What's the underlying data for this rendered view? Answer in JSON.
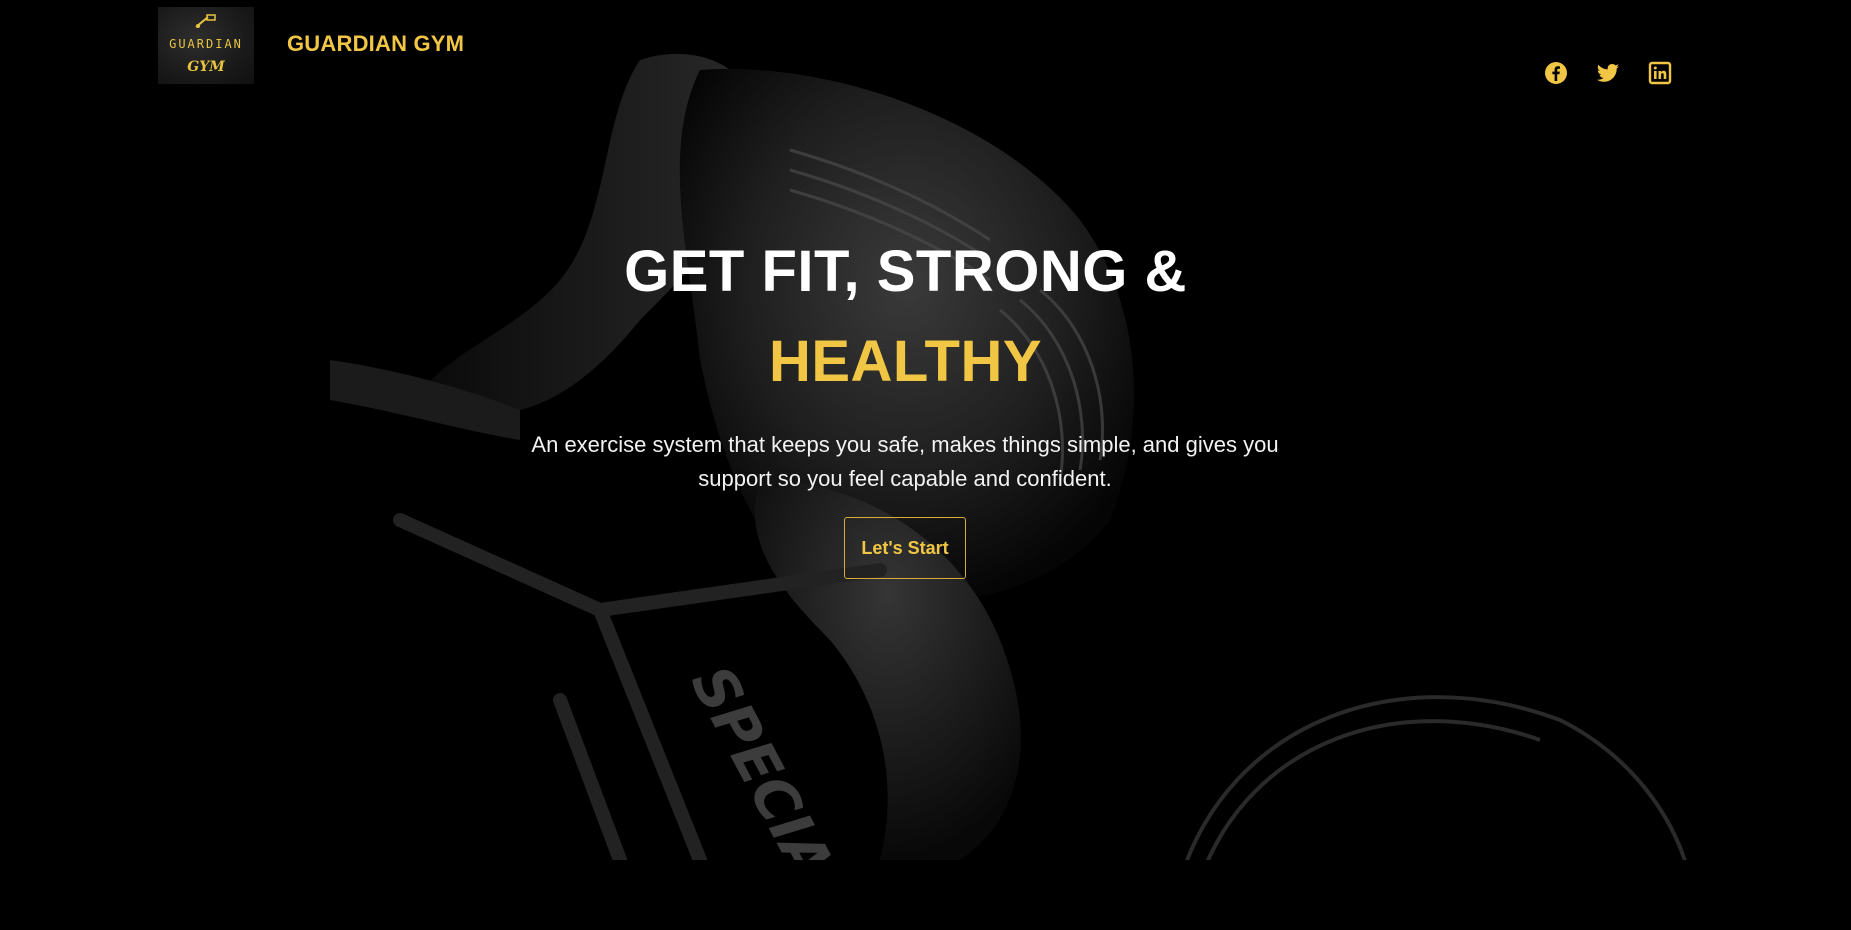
{
  "header": {
    "logo": {
      "top_text": "GUARDIAN",
      "bottom_text": "GYM"
    },
    "brand_name": "GUARDIAN GYM",
    "social": [
      {
        "name": "facebook-icon"
      },
      {
        "name": "twitter-icon"
      },
      {
        "name": "linkedin-icon"
      }
    ]
  },
  "hero": {
    "title_line1": "GET FIT, STRONG &",
    "title_line2": "HEALTHY",
    "subtitle": "An exercise system that keeps you safe, makes things simple, and gives you support so you feel capable and confident.",
    "cta_label": "Let's Start",
    "background_lettering": "SPECIAL"
  },
  "colors": {
    "accent": "#f1c644",
    "background": "#000000",
    "text": "#ffffff"
  }
}
